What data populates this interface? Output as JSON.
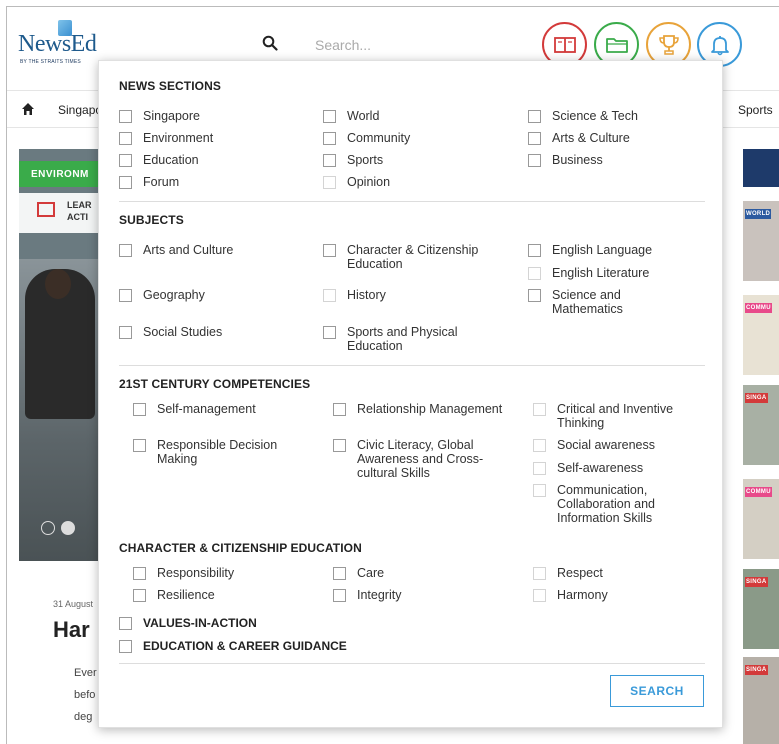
{
  "header": {
    "logo_text": "NewsEd",
    "logo_subtitle": "BY THE STRAITS TIMES",
    "search_placeholder": "Search...",
    "icon_buttons": [
      "book-icon",
      "folder-icon",
      "trophy-icon",
      "bell-icon"
    ]
  },
  "navbar": {
    "item_singapore": "Singapo",
    "item_sports": "Sports"
  },
  "hero": {
    "tag": "ENVIRONM",
    "learn_line1": "LEAR",
    "learn_line2": "ACTI"
  },
  "article": {
    "date": "31 August",
    "title": "Har",
    "lines": [
      "Ever",
      "befo",
      "deg"
    ]
  },
  "right_column": {
    "labels": [
      "WORLD",
      "COMMU",
      "SINGA",
      "COMMU",
      "SINGA",
      "SINGA"
    ],
    "colors": [
      "#2c5aa0",
      "#e84a8a",
      "#d33a3a",
      "#e84a8a",
      "#d33a3a",
      "#d33a3a"
    ]
  },
  "panel": {
    "news_sections": {
      "title": "NEWS SECTIONS",
      "items": [
        "Singapore",
        "World",
        "Science & Tech",
        "Environment",
        "Community",
        "Arts & Culture",
        "Education",
        "Sports",
        "Business",
        "Forum",
        "Opinion"
      ]
    },
    "subjects": {
      "title": "SUBJECTS",
      "items": [
        "Arts and Culture",
        "Character & Citizenship Education",
        "English Language",
        "English Literature",
        "Geography",
        "History",
        "Science and Mathematics",
        "Social Studies",
        "Sports and Physical Education"
      ]
    },
    "competencies": {
      "title": "21ST CENTURY COMPETENCIES",
      "items": [
        "Self-management",
        "Relationship Management",
        "Critical and Inventive Thinking",
        "Responsible Decision Making",
        "Civic Literacy, Global Awareness and Cross-cultural Skills",
        "Social awareness",
        "Self-awareness",
        "Communication, Collaboration and Information Skills"
      ]
    },
    "cce": {
      "title": "CHARACTER & CITIZENSHIP EDUCATION",
      "items": [
        "Responsibility",
        "Care",
        "Respect",
        "Resilience",
        "Integrity",
        "Harmony"
      ]
    },
    "values_in_action": "VALUES-IN-ACTION",
    "education_career": "EDUCATION & CAREER GUIDANCE",
    "search_button": "SEARCH"
  }
}
